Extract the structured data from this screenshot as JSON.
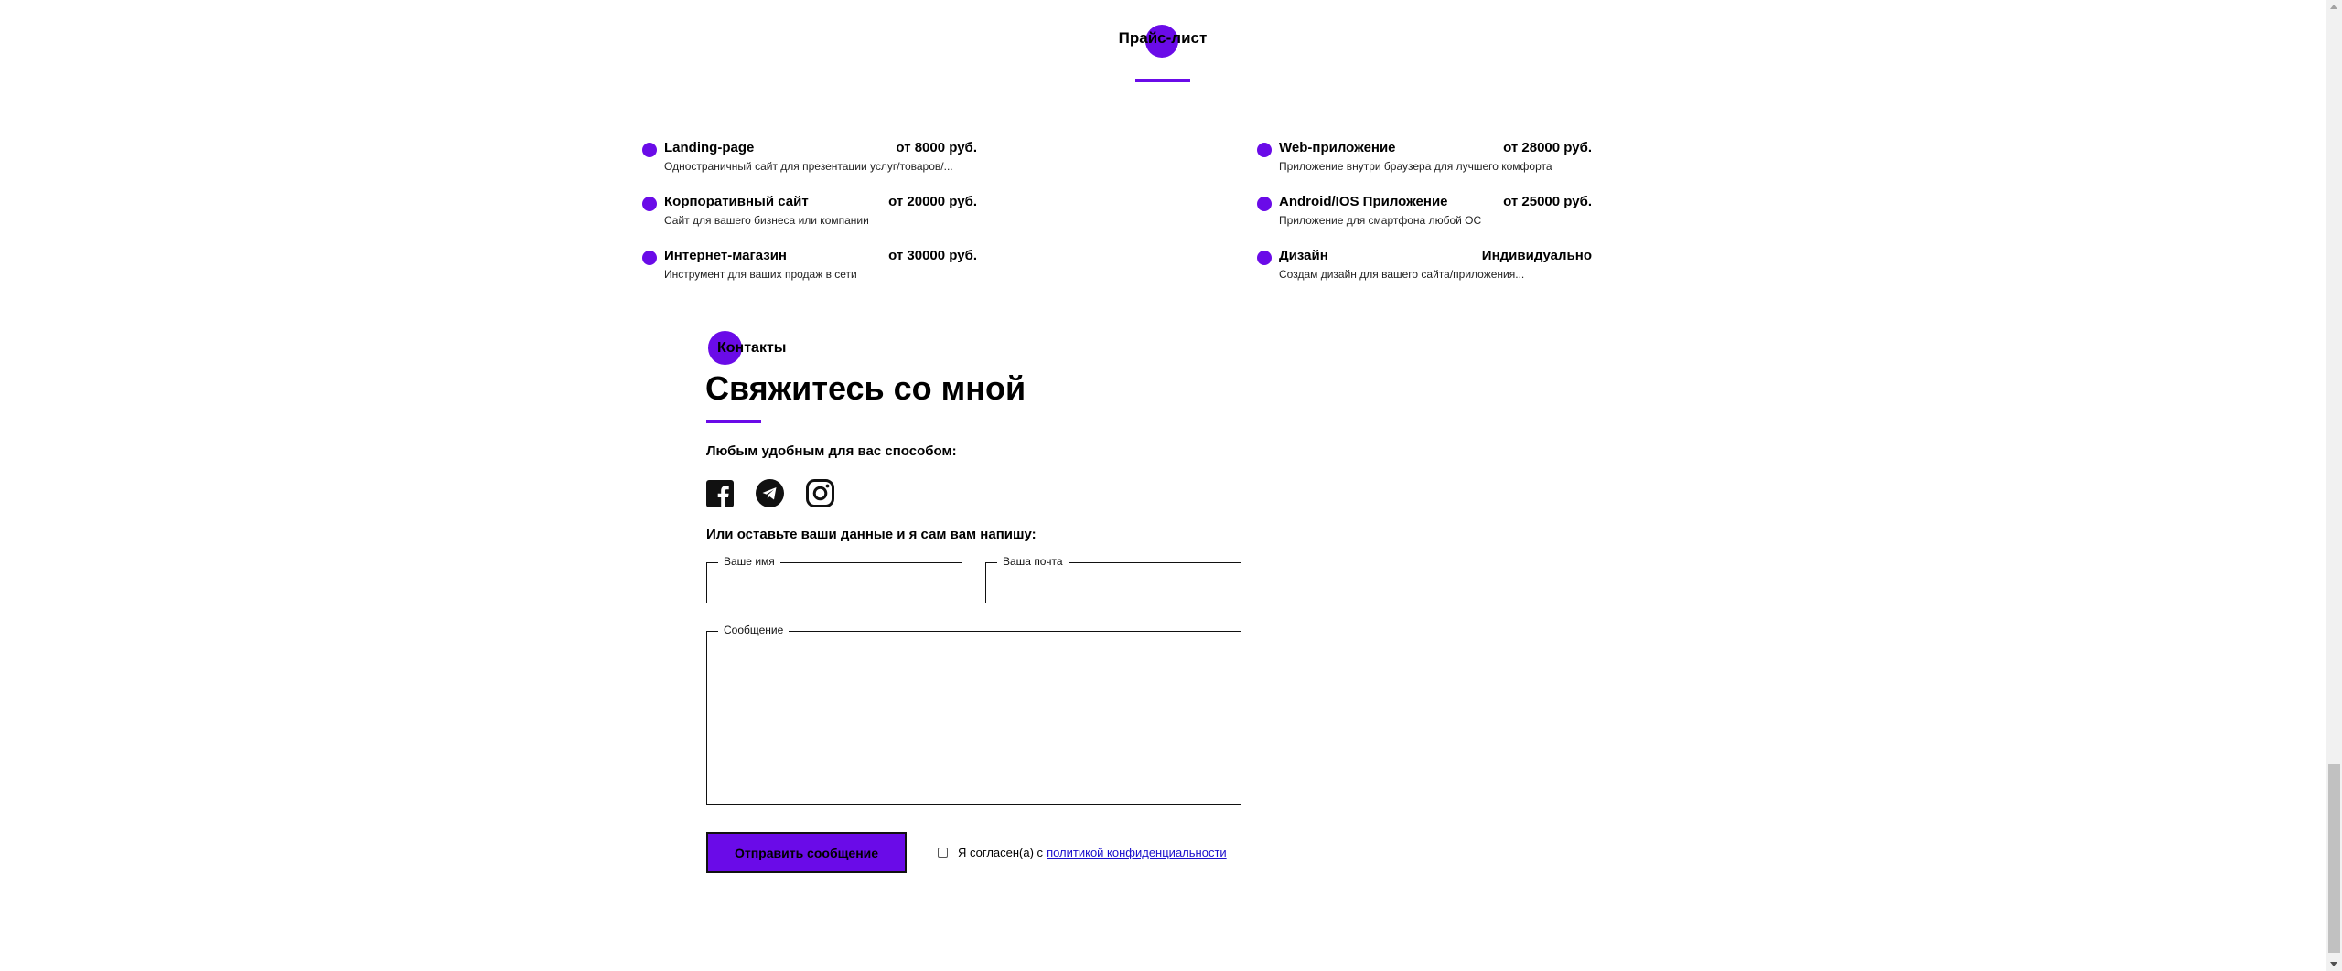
{
  "price_list": {
    "title": "Прайс-лист",
    "left_items": [
      {
        "name": "Landing-page",
        "price": "от 8000 руб.",
        "description": "Одностраничный сайт для презентации услуг/товаров/..."
      },
      {
        "name": "Корпоративный сайт",
        "price": "от 20000 руб.",
        "description": "Сайт для вашего бизнеса или компании"
      },
      {
        "name": "Интернет-магазин",
        "price": "от 30000 руб.",
        "description": "Инструмент для ваших продаж в сети"
      }
    ],
    "right_items": [
      {
        "name": "Web-приложение",
        "price": "от 28000 руб.",
        "description": "Приложение внутри браузера для лучшего комфорта"
      },
      {
        "name": "Android/IOS Приложение",
        "price": "от 25000 руб.",
        "description": "Приложение для смартфона любой ОС"
      },
      {
        "name": "Дизайн",
        "price": "Индивидуально",
        "description": "Создам дизайн для вашего сайта/приложения..."
      }
    ]
  },
  "contacts": {
    "label": "Контакты",
    "heading": "Свяжитесь со мной",
    "subheading": "Любым удобным для вас способом:",
    "socials": [
      {
        "icon": "facebook-icon"
      },
      {
        "icon": "telegram-icon"
      },
      {
        "icon": "instagram-icon"
      }
    ],
    "form_subheading": "Или оставьте ваши данные и я сам вам напишу:",
    "form": {
      "name_label": "Ваше имя",
      "email_label": "Ваша почта",
      "message_label": "Сообщение",
      "name_value": "",
      "email_value": "",
      "message_value": "",
      "submit_label": "Отправить сообщение",
      "agree_text": "Я согласен(а) с",
      "agree_link": "политикой конфиденциальности",
      "agree_checked": false
    }
  },
  "colors": {
    "accent": "#6a0be8",
    "text": "#000000",
    "link": "#1a0dcc",
    "background": "#ffffff"
  }
}
